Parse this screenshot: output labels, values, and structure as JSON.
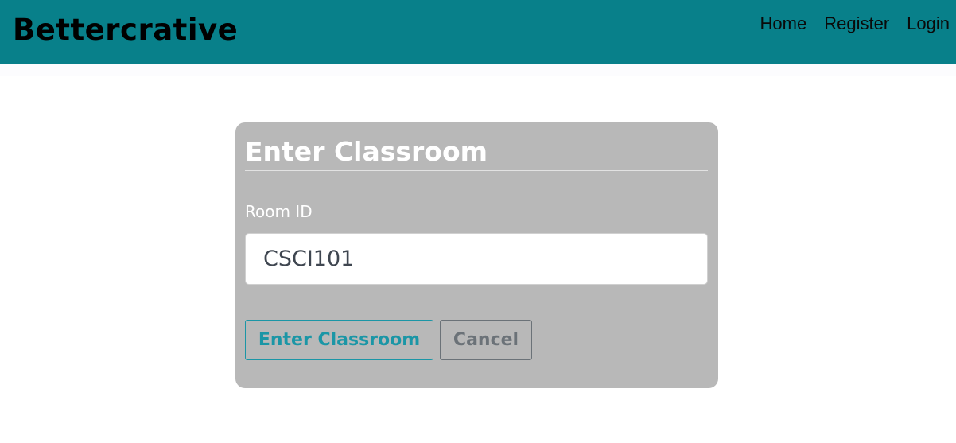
{
  "navbar": {
    "brand": "Bettercrative",
    "links": [
      {
        "label": "Home"
      },
      {
        "label": "Register"
      },
      {
        "label": "Login"
      }
    ],
    "color": "#08808a"
  },
  "form": {
    "title": "Enter Classroom",
    "room_id_label": "Room ID",
    "room_id_value": "CSCI101",
    "submit_label": "Enter Classroom",
    "cancel_label": "Cancel",
    "card_color": "#b8b8b8",
    "accent_color": "#1b96a6"
  }
}
